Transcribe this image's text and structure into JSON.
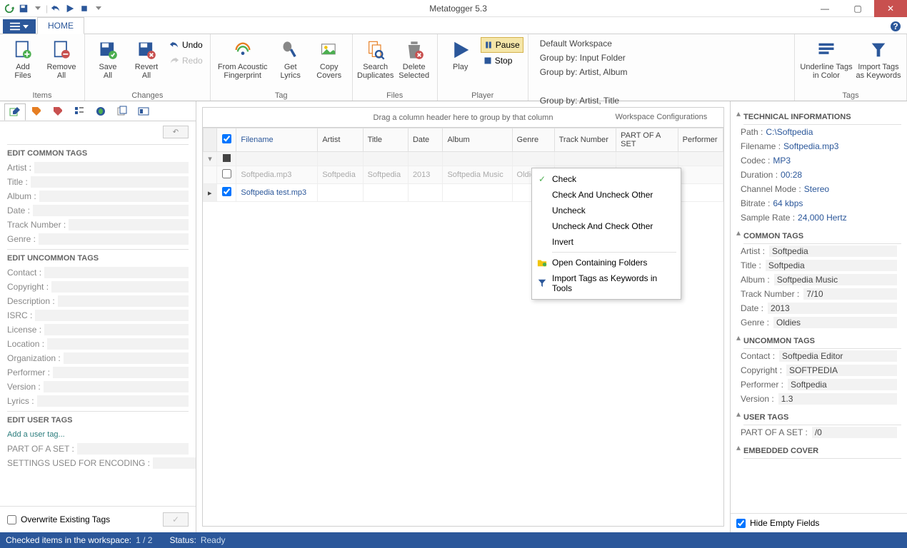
{
  "app": {
    "title": "Metatogger 5.3"
  },
  "tabs": {
    "file": "",
    "home": "HOME"
  },
  "ribbon": {
    "items": {
      "add": "Add\nFiles",
      "remove": "Remove\nAll",
      "save": "Save\nAll",
      "revert": "Revert\nAll",
      "undo": "Undo",
      "redo": "Redo",
      "acoustic": "From Acoustic\nFingerprint",
      "lyrics": "Get\nLyrics",
      "covers": "Copy\nCovers",
      "searchdup": "Search\nDuplicates",
      "delsel": "Delete\nSelected",
      "play": "Play",
      "pause": "Pause",
      "stop": "Stop",
      "underline": "Underline Tags\nin Color",
      "importkw": "Import Tags\nas Keywords"
    },
    "groups": {
      "items": "Items",
      "changes": "Changes",
      "tag": "Tag",
      "files": "Files",
      "player": "Player",
      "workspace": "Workspace Configurations",
      "tags": "Tags"
    },
    "ws": [
      "Default Workspace",
      "Group by: Artist, Album",
      "Group by: Artist, Title",
      "Group by: Input Folder"
    ]
  },
  "left": {
    "sections": {
      "common": "EDIT COMMON TAGS",
      "uncommon": "EDIT UNCOMMON TAGS",
      "user": "EDIT USER TAGS"
    },
    "common": [
      "Artist :",
      "Title :",
      "Album :",
      "Date :",
      "Track Number :",
      "Genre :"
    ],
    "uncommon": [
      "Contact :",
      "Copyright :",
      "Description :",
      "ISRC :",
      "License :",
      "Location :",
      "Organization :",
      "Performer :",
      "Version :",
      "Lyrics :"
    ],
    "user": [
      "PART OF A SET :",
      "SETTINGS USED FOR ENCODING :"
    ],
    "addTag": "Add a user tag...",
    "overwrite": "Overwrite Existing Tags"
  },
  "grid": {
    "groupHint": "Drag a column header here to group by that column",
    "cols": [
      "Filename",
      "Artist",
      "Title",
      "Date",
      "Album",
      "Genre",
      "Track Number",
      "PART OF A SET",
      "Performer"
    ],
    "rows": [
      {
        "checked": false,
        "cells": [
          "Softpedia.mp3",
          "Softpedia",
          "Softpedia",
          "2013",
          "Softpedia Music",
          "Oldies",
          "",
          "",
          ""
        ],
        "dim": true
      },
      {
        "checked": true,
        "cells": [
          "Softpedia test.mp3",
          "",
          "",
          "",
          "",
          "",
          "",
          "",
          ""
        ],
        "dim": false
      }
    ]
  },
  "ctx": {
    "check": "Check",
    "checkUncheck": "Check And Uncheck Other",
    "uncheck": "Uncheck",
    "uncheckCheck": "Uncheck And Check Other",
    "invert": "Invert",
    "openFolders": "Open Containing Folders",
    "importKw": "Import Tags as Keywords in Tools"
  },
  "right": {
    "tech": {
      "title": "TECHNICAL INFORMATIONS",
      "rows": [
        [
          "Path :",
          "C:\\Softpedia"
        ],
        [
          "Filename :",
          "Softpedia.mp3"
        ],
        [
          "Codec :",
          "MP3"
        ],
        [
          "Duration :",
          "00:28"
        ],
        [
          "Channel Mode :",
          "Stereo"
        ],
        [
          "Bitrate :",
          "64 kbps"
        ],
        [
          "Sample Rate :",
          "24,000 Hertz"
        ]
      ]
    },
    "common": {
      "title": "COMMON TAGS",
      "rows": [
        [
          "Artist :",
          "Softpedia"
        ],
        [
          "Title :",
          "Softpedia"
        ],
        [
          "Album :",
          "Softpedia Music"
        ],
        [
          "Track Number :",
          "7/10"
        ],
        [
          "Date :",
          "2013"
        ],
        [
          "Genre :",
          "Oldies"
        ]
      ]
    },
    "uncommon": {
      "title": "UNCOMMON TAGS",
      "rows": [
        [
          "Contact :",
          "Softpedia Editor"
        ],
        [
          "Copyright :",
          "SOFTPEDIA"
        ],
        [
          "Performer :",
          "Softpedia"
        ],
        [
          "Version :",
          "1.3"
        ]
      ]
    },
    "user": {
      "title": "USER TAGS",
      "rows": [
        [
          "PART OF A SET :",
          "/0"
        ]
      ]
    },
    "cover": {
      "title": "EMBEDDED COVER"
    },
    "hideEmpty": "Hide Empty Fields"
  },
  "status": {
    "checked": "Checked items in the workspace:",
    "count": "1 / 2",
    "statusLbl": "Status:",
    "statusVal": "Ready"
  }
}
